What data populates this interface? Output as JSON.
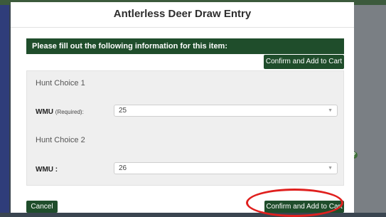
{
  "modal": {
    "title": "Antlerless Deer Draw Entry",
    "header_text": "Please fill out the following information for this item:",
    "confirm_top_label": "Confirm and Add to Cart",
    "hunt_choices": [
      {
        "heading": "Hunt Choice 1",
        "label": "WMU",
        "required_note": "(Required):",
        "value": "25"
      },
      {
        "heading": "Hunt Choice 2",
        "label": "WMU :",
        "required_note": "",
        "value": "26"
      }
    ],
    "cancel_label": "Cancel",
    "confirm_bottom_label": "Confirm and Add to Cart"
  },
  "page": {
    "help_glyph": "?"
  },
  "colors": {
    "accent": "#1f4d2b",
    "highlight": "#e0201e"
  }
}
